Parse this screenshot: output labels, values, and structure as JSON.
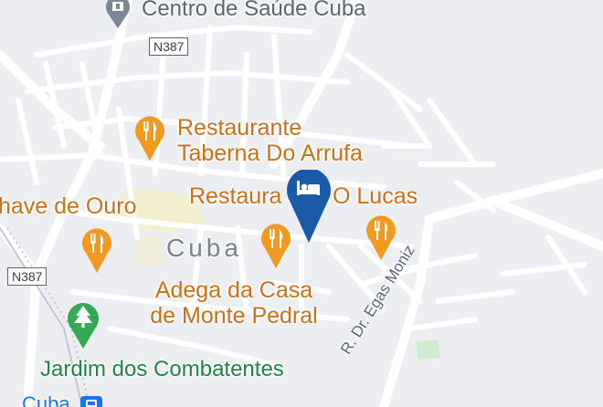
{
  "map": {
    "colors": {
      "background": "#eceef1",
      "road": "#ffffff",
      "park": "#cdeccd",
      "town_area": "#f6efc9",
      "food": "#f19a1f",
      "hotel": "#1a5aa8",
      "park_pin": "#34a853",
      "health": "#7b8794",
      "transit": "#1a73e8"
    },
    "top_label": "Centro de Saúde Cuba",
    "shields": [
      "N387",
      "N387"
    ],
    "restaurants": [
      {
        "line1": "Restaurante",
        "line2": "Taberna Do Arrufa"
      },
      {
        "line1": "Restaura",
        "line2": "O Lucas"
      },
      {
        "line1": "have de Ouro"
      },
      {
        "line1": "Adega da Casa",
        "line2": "de Monte Pedral"
      }
    ],
    "town_label": "Cuba",
    "street_label": "R. Dr. Egas Moniz",
    "park_label": "Jardim dos Combatentes",
    "transit_label": "Cuba",
    "icons": {
      "health": "hospital-icon",
      "restaurant": "fork-knife-icon",
      "hotel": "bed-icon",
      "park": "tree-icon",
      "transit": "train-icon"
    }
  }
}
